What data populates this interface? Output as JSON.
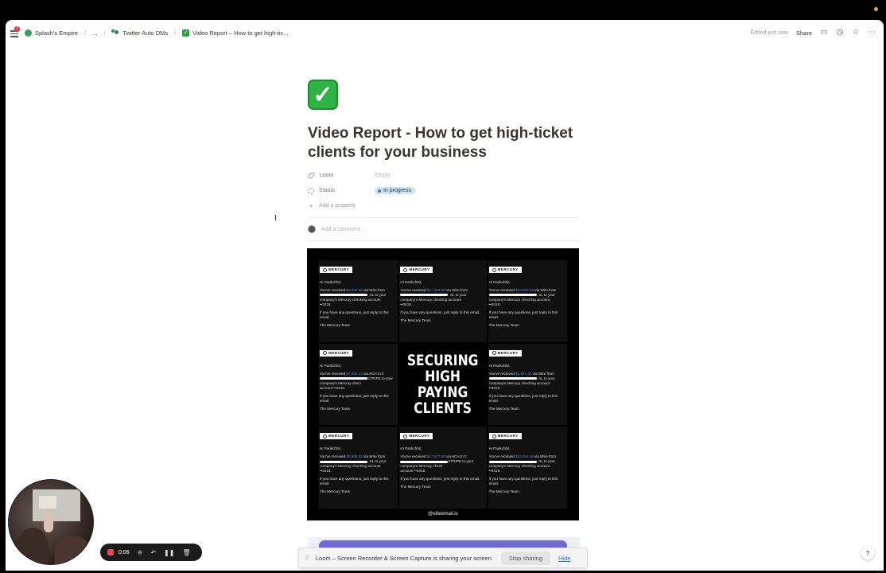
{
  "topbar": {
    "menu_badge": "7",
    "breadcrumbs": [
      {
        "label": "Splash's Empire"
      },
      {
        "label": "..."
      },
      {
        "label": "Twitter Auto DMs"
      },
      {
        "label": "Video Report – How to get high-tic..."
      }
    ],
    "edited": "Edited just now",
    "share": "Share"
  },
  "page": {
    "emoji": "✓",
    "title": "Video Report - How to get high-ticket clients for your business",
    "properties": [
      {
        "key": "Loom",
        "value": "Empty"
      },
      {
        "key": "Status",
        "value": "In progress"
      }
    ],
    "add_property": "Add a property",
    "comment_placeholder": "Add a comment..."
  },
  "thumbnail": {
    "headline": [
      "SECURING",
      "HIGH",
      "PAYING",
      "CLIENTS"
    ],
    "footer": "@eliteemail.io",
    "brand": "MERCURY",
    "emails": [
      {
        "greet": "Hi Parikchhit,",
        "pre": "You've received",
        "amount": "$9,294.86",
        "post": "via Wire from",
        "line2": ". SL to your",
        "line3": "company's Mercury checking account",
        "line4": "••3418.",
        "q": "If you have any questions, just reply to this email.",
        "sign": "The Mercury Team"
      },
      {
        "greet": "Hi Parikchhit,",
        "pre": "You've received",
        "amount": "$17,463.88",
        "post": "via Wire from",
        "line2": ". SL to your",
        "line3": "company's Mercury checking account",
        "line4": "••3418.",
        "q": "If you have any questions, just reply to this email.",
        "sign": "The Mercury Team"
      },
      {
        "greet": "Hi Parikchhit,",
        "pre": "You've received",
        "amount": "$15,883.36",
        "post": "via Wire from",
        "line2": ". SL to your",
        "line3": "company's Mercury checking account",
        "line4": "••3418.",
        "q": "If you have any questions, just reply to this email.",
        "sign": "The Mercury Team"
      },
      {
        "greet": "Hi Parikchhit,",
        "pre": "You've received",
        "amount": "$7,094.24",
        "post": "via ACH In fr",
        "line2": "STRIPE to your company's Mercury checi",
        "line3": "account ••3418.",
        "line4": "",
        "q": "If you have any questions, just reply to this email.",
        "sign": "The Mercury Team"
      },
      {
        "greet": "Hi Parikchhit,",
        "pre": "You've received",
        "amount": "$5,557.40",
        "post": "via Wire from",
        "line2": ". SL to your",
        "line3": "company's Mercury checking account",
        "line4": "••3418.",
        "q": "If you have any questions, just reply to this email.",
        "sign": "The Mercury Team"
      },
      {
        "greet": "Hi Parikchhit,",
        "pre": "You've received",
        "amount": "$9,908.82",
        "post": "via Wire from",
        "line2": ". SL to your",
        "line3": "company's Mercury checking account",
        "line4": "••3418.",
        "q": "If you have any questions, just reply to this email.",
        "sign": "The Mercury Team"
      },
      {
        "greet": "Hi Parikchhit,",
        "pre": "You've received",
        "amount": "$17,277.06",
        "post": "via ACH In fr",
        "line2": "STRIPE to your company's Mercury check",
        "line3": "account ••3418.",
        "line4": "",
        "q": "If you have any questions, just reply to this email.",
        "sign": "The Mercury Team"
      },
      {
        "greet": "Hi Parikchhit,",
        "pre": "You've received",
        "amount": "$11,094.48",
        "post": "via Wire from",
        "line2": ". SL to your",
        "line3": "company's Mercury checking account",
        "line4": "••3418.",
        "q": "If you have any questions, just reply to this email.",
        "sign": "The Mercury Team"
      }
    ]
  },
  "recorder": {
    "time": "0:06"
  },
  "sharing": {
    "message": "Loom – Screen Recorder & Screen Capture is sharing your screen.",
    "stop": "Stop sharing",
    "hide": "Hide"
  },
  "help": "?",
  "colors": {
    "accent_green": "#2fb344",
    "status_pill_bg": "#d3e5ef",
    "record_red": "#e5484d",
    "link_blue": "#1a73e8"
  }
}
